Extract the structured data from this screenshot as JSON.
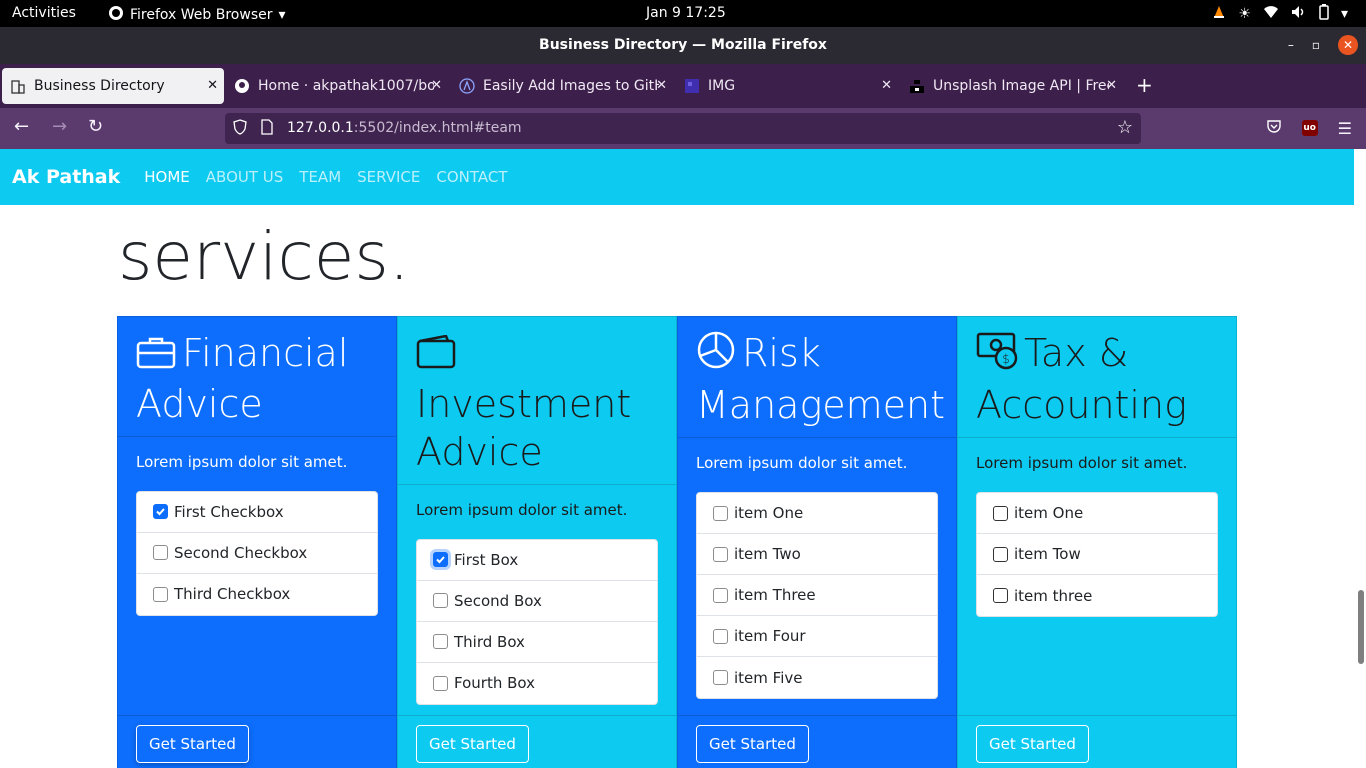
{
  "system_bar": {
    "activities": "Activities",
    "app_name": "Firefox Web Browser",
    "clock": "Jan 9  17:25"
  },
  "window": {
    "title": "Business Directory — Mozilla Firefox"
  },
  "tabs": [
    {
      "label": "Business Directory",
      "active": true,
      "icon": "building-icon"
    },
    {
      "label": "Home · akpathak1007/bo",
      "active": false,
      "icon": "github-icon"
    },
    {
      "label": "Easily Add Images to GitH",
      "active": false,
      "icon": "a-logo-icon"
    },
    {
      "label": "IMG",
      "active": false,
      "icon": "img-favicon-icon"
    },
    {
      "label": "Unsplash Image API | Free",
      "active": false,
      "icon": "unsplash-icon"
    }
  ],
  "new_tab": "+",
  "url": {
    "host": "127.0.0.1",
    "rest": ":5502/index.html#team"
  },
  "site": {
    "brand": "Ak Pathak",
    "nav": [
      "HOME",
      "ABOUT US",
      "TEAM",
      "SERVICE",
      "CONTACT"
    ],
    "heading": "services."
  },
  "cards": [
    {
      "title": "Financial Advice",
      "icon": "briefcase-icon",
      "color": "#0d6efd",
      "text": "Lorem ipsum dolor sit amet.",
      "items": [
        {
          "label": "First Checkbox",
          "checked": true
        },
        {
          "label": " Second Checkbox",
          "checked": false
        },
        {
          "label": "Third Checkbox",
          "checked": false
        }
      ],
      "button": "Get Started"
    },
    {
      "title": "Investment Advice",
      "icon": "wallet-icon",
      "color": "#0dcaf0",
      "text": "Lorem ipsum dolor sit amet.",
      "items": [
        {
          "label": "First Box",
          "checked": true
        },
        {
          "label": "Second Box",
          "checked": false
        },
        {
          "label": "Third Box",
          "checked": false
        },
        {
          "label": "Fourth Box",
          "checked": false
        }
      ],
      "button": "Get Started"
    },
    {
      "title": "Risk Management",
      "icon": "pie-chart-icon",
      "color": "#0d6efd",
      "text": "Lorem ipsum dolor sit amet.",
      "items": [
        {
          "label": "item One",
          "checked": false
        },
        {
          "label": "item Two",
          "checked": false
        },
        {
          "label": "item Three",
          "checked": false
        },
        {
          "label": "item Four",
          "checked": false
        },
        {
          "label": "item Five",
          "checked": false
        }
      ],
      "button": "Get Started"
    },
    {
      "title": "Tax & Accounting",
      "icon": "cash-coin-icon",
      "color": "#0dcaf0",
      "text": "Lorem ipsum dolor sit amet.",
      "items": [
        {
          "label": "item One",
          "checked": false
        },
        {
          "label": "item Tow",
          "checked": false
        },
        {
          "label": "item three",
          "checked": false
        }
      ],
      "button": "Get Started"
    }
  ]
}
